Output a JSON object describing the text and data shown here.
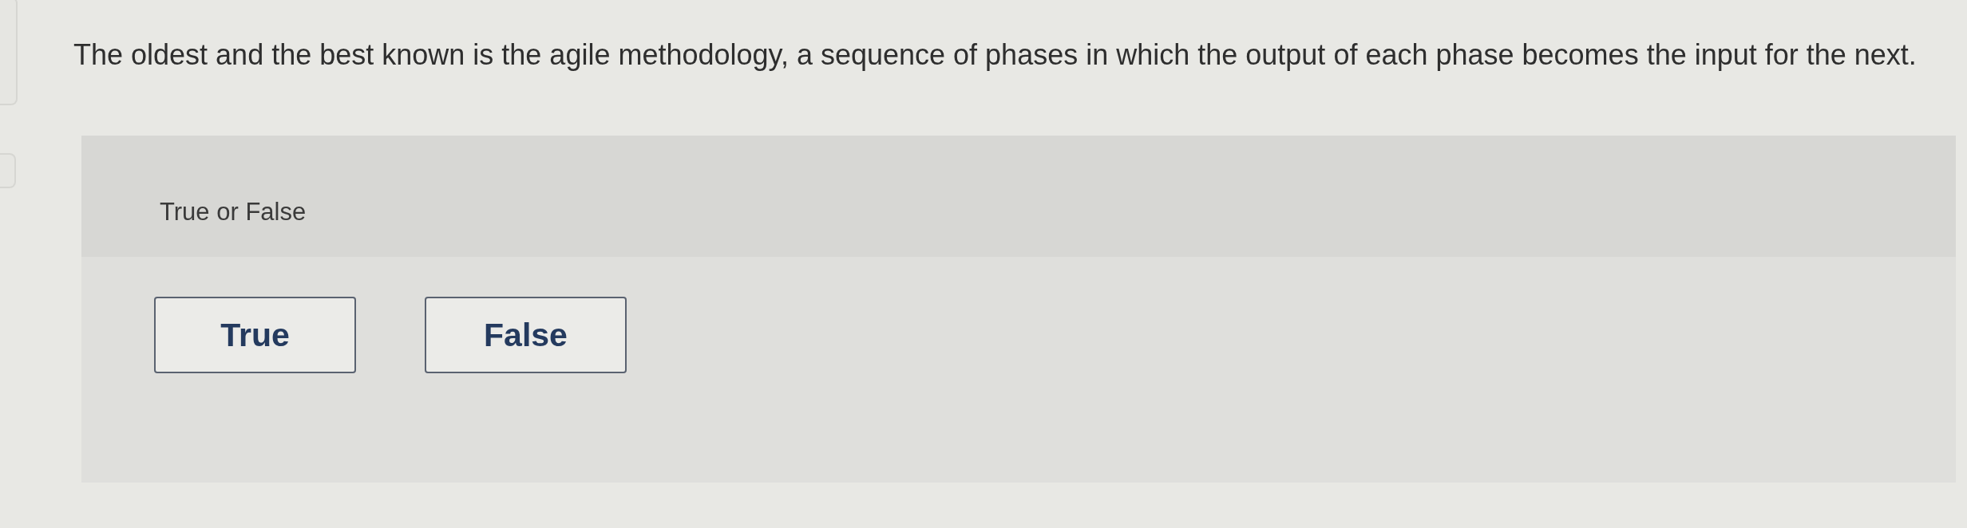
{
  "question": "The oldest and the best known is the agile methodology, a sequence of phases in which the output of each phase becomes the input for the next.",
  "panel": {
    "title": "True or False",
    "options": [
      {
        "label": "True",
        "selected": false
      },
      {
        "label": "False",
        "selected": false
      }
    ]
  }
}
